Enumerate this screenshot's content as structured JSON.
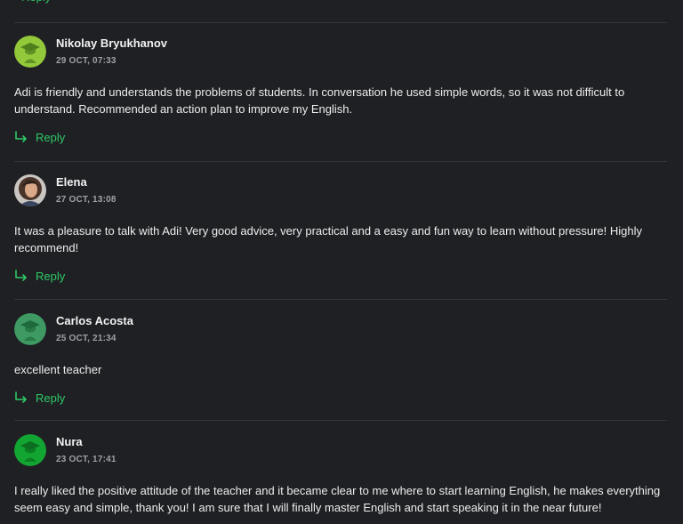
{
  "colors": {
    "background": "#1f2023",
    "accent": "#2ec866",
    "divider": "#34363b",
    "avatar_nikolay": "#93c83a",
    "avatar_carlos": "#3e9a62",
    "avatar_nura": "#12a531"
  },
  "reply_label": "Reply",
  "comments": [
    {
      "name": "Nikolay Bryukhanov",
      "date": "29 OCT, 07:33",
      "text": "Adi is friendly and understands the problems of students. In conversation he used simple words, so it was not difficult to understand. Recommended an action plan to improve my English.",
      "avatar": "graduate-avatar-icon"
    },
    {
      "name": "Elena",
      "date": "27 OCT, 13:08",
      "text": "It was a pleasure to talk with Adi! Very good advice, very practical and a easy and fun way to learn without pressure! Highly recommend!",
      "avatar": "user-photo"
    },
    {
      "name": "Carlos Acosta",
      "date": "25 OCT, 21:34",
      "text": "excellent teacher",
      "avatar": "graduate-avatar-icon"
    },
    {
      "name": "Nura",
      "date": "23 OCT, 17:41",
      "text": "I really liked the positive attitude of the teacher and it became clear to me where to start learning English, he makes everything seem easy and simple, thank you! I am sure that I will finally master English and start speaking it in the near future!",
      "avatar": "graduate-avatar-icon"
    }
  ]
}
